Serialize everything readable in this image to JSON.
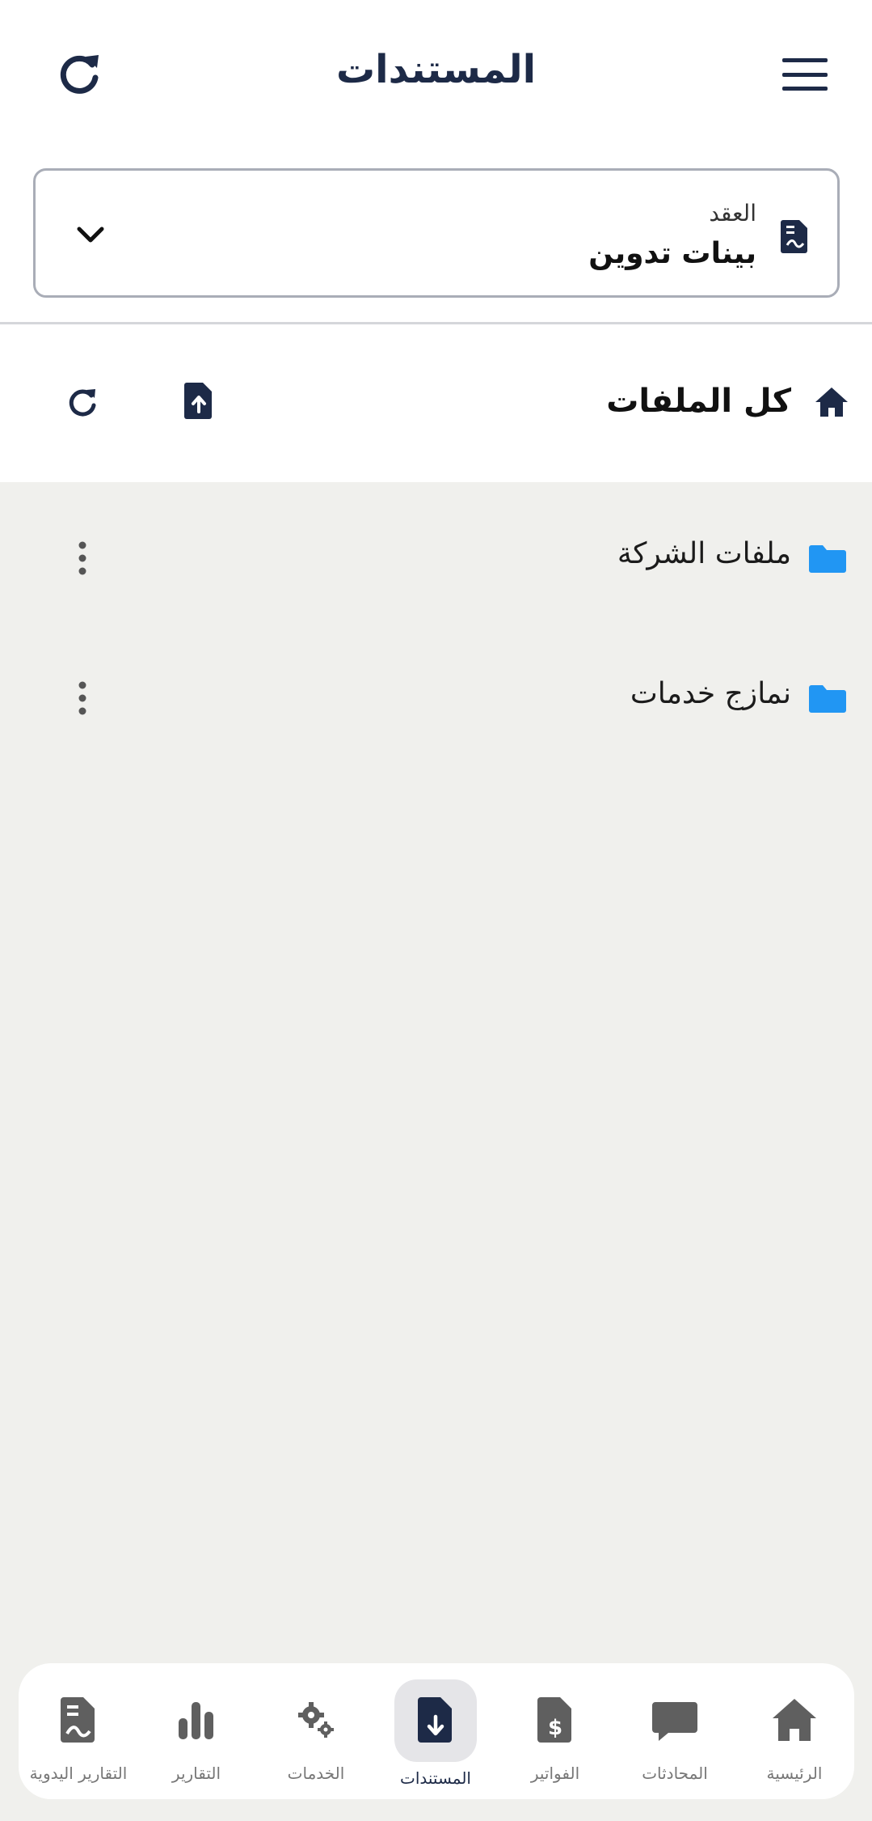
{
  "header": {
    "title": "المستندات",
    "menu_icon": "hamburger-menu-icon",
    "refresh_icon": "refresh-icon"
  },
  "contract": {
    "label": "العقد",
    "value": "بينات تدوين",
    "icon": "contract-document-icon",
    "dropdown_icon": "chevron-down-icon"
  },
  "toolbar": {
    "title": "كل الملفات",
    "home_icon": "home-icon",
    "upload_icon": "file-upload-icon",
    "refresh_icon": "refresh-icon"
  },
  "folders": [
    {
      "name": "ملفات الشركة",
      "icon": "folder-icon",
      "menu_icon": "more-vertical-icon"
    },
    {
      "name": "نمازج خدمات",
      "icon": "folder-icon",
      "menu_icon": "more-vertical-icon"
    }
  ],
  "bottom_nav": {
    "items": [
      {
        "label": "الرئيسية",
        "icon": "home-icon"
      },
      {
        "label": "المحادثات",
        "icon": "chat-icon"
      },
      {
        "label": "الفواتير",
        "icon": "invoice-dollar-icon"
      },
      {
        "label": "المستندات",
        "icon": "file-download-icon",
        "active": true
      },
      {
        "label": "الخدمات",
        "icon": "gears-icon"
      },
      {
        "label": "التقارير",
        "icon": "bar-chart-icon"
      },
      {
        "label": "التقارير اليدوية",
        "icon": "file-report-icon"
      }
    ]
  },
  "colors": {
    "primary": "#1d2a47",
    "folder": "#2196f3",
    "background": "#f0f0ed",
    "nav_icon": "#5f5f5f"
  }
}
